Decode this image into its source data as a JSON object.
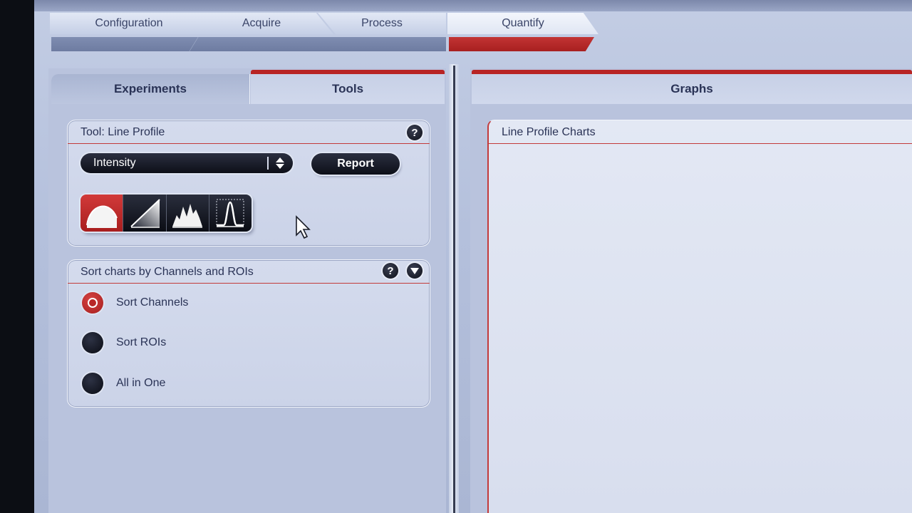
{
  "workflow": {
    "tabs": [
      {
        "label": "Configuration",
        "active": false
      },
      {
        "label": "Acquire",
        "active": false
      },
      {
        "label": "Process",
        "active": false
      },
      {
        "label": "Quantify",
        "active": true
      }
    ]
  },
  "left_panel": {
    "tabs": [
      {
        "label": "Experiments",
        "active": false
      },
      {
        "label": "Tools",
        "active": true
      }
    ],
    "tool_box": {
      "title": "Tool: Line Profile",
      "help": "?",
      "dropdown_value": "Intensity",
      "report_label": "Report",
      "icons": [
        "curve-profile-icon",
        "diagonal-gradient-icon",
        "histogram-peaks-icon",
        "peak-chart-icon"
      ],
      "active_icon_index": 0
    },
    "sort_box": {
      "title": "Sort charts by Channels and ROIs",
      "help": "?",
      "options": [
        {
          "label": "Sort Channels",
          "selected": true
        },
        {
          "label": "Sort ROIs",
          "selected": false
        },
        {
          "label": "All in One",
          "selected": false
        }
      ]
    }
  },
  "right_panel": {
    "tab_label": "Graphs",
    "chart_box_title": "Line Profile Charts"
  },
  "colors": {
    "accent_red": "#b82424",
    "dark_control": "#0d0f18",
    "panel_bg": "#b9c3dd"
  }
}
